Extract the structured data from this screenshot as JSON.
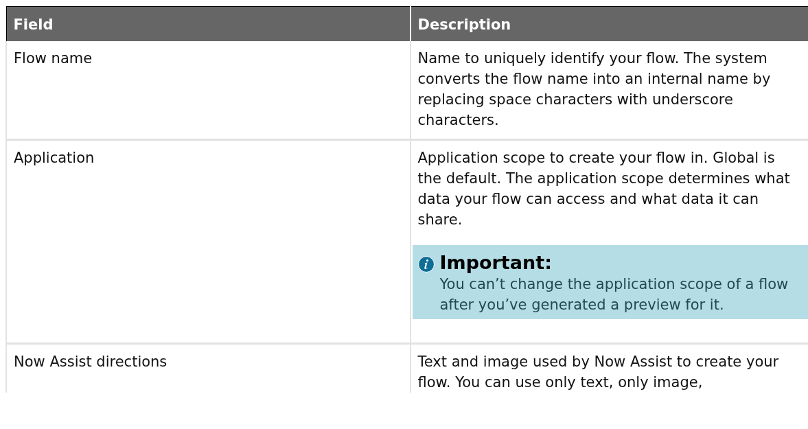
{
  "table": {
    "columns": [
      "Field",
      "Description"
    ],
    "rows": [
      {
        "field": "Flow name",
        "description": "Name to uniquely identify your flow. The system converts the flow name into an internal name by replacing space characters with underscore characters."
      },
      {
        "field": "Application",
        "description": "Application scope to create your flow in. Global is the default. The application scope determines what data your flow can access and what data it can share.",
        "note": {
          "title": "Important:",
          "text": "You can’t change the application scope of a flow after you’ve generated a preview for it."
        }
      },
      {
        "field": "Now Assist directions",
        "description": "Text and image used by Now Assist to create your flow. You can use only text, only image,"
      }
    ]
  }
}
